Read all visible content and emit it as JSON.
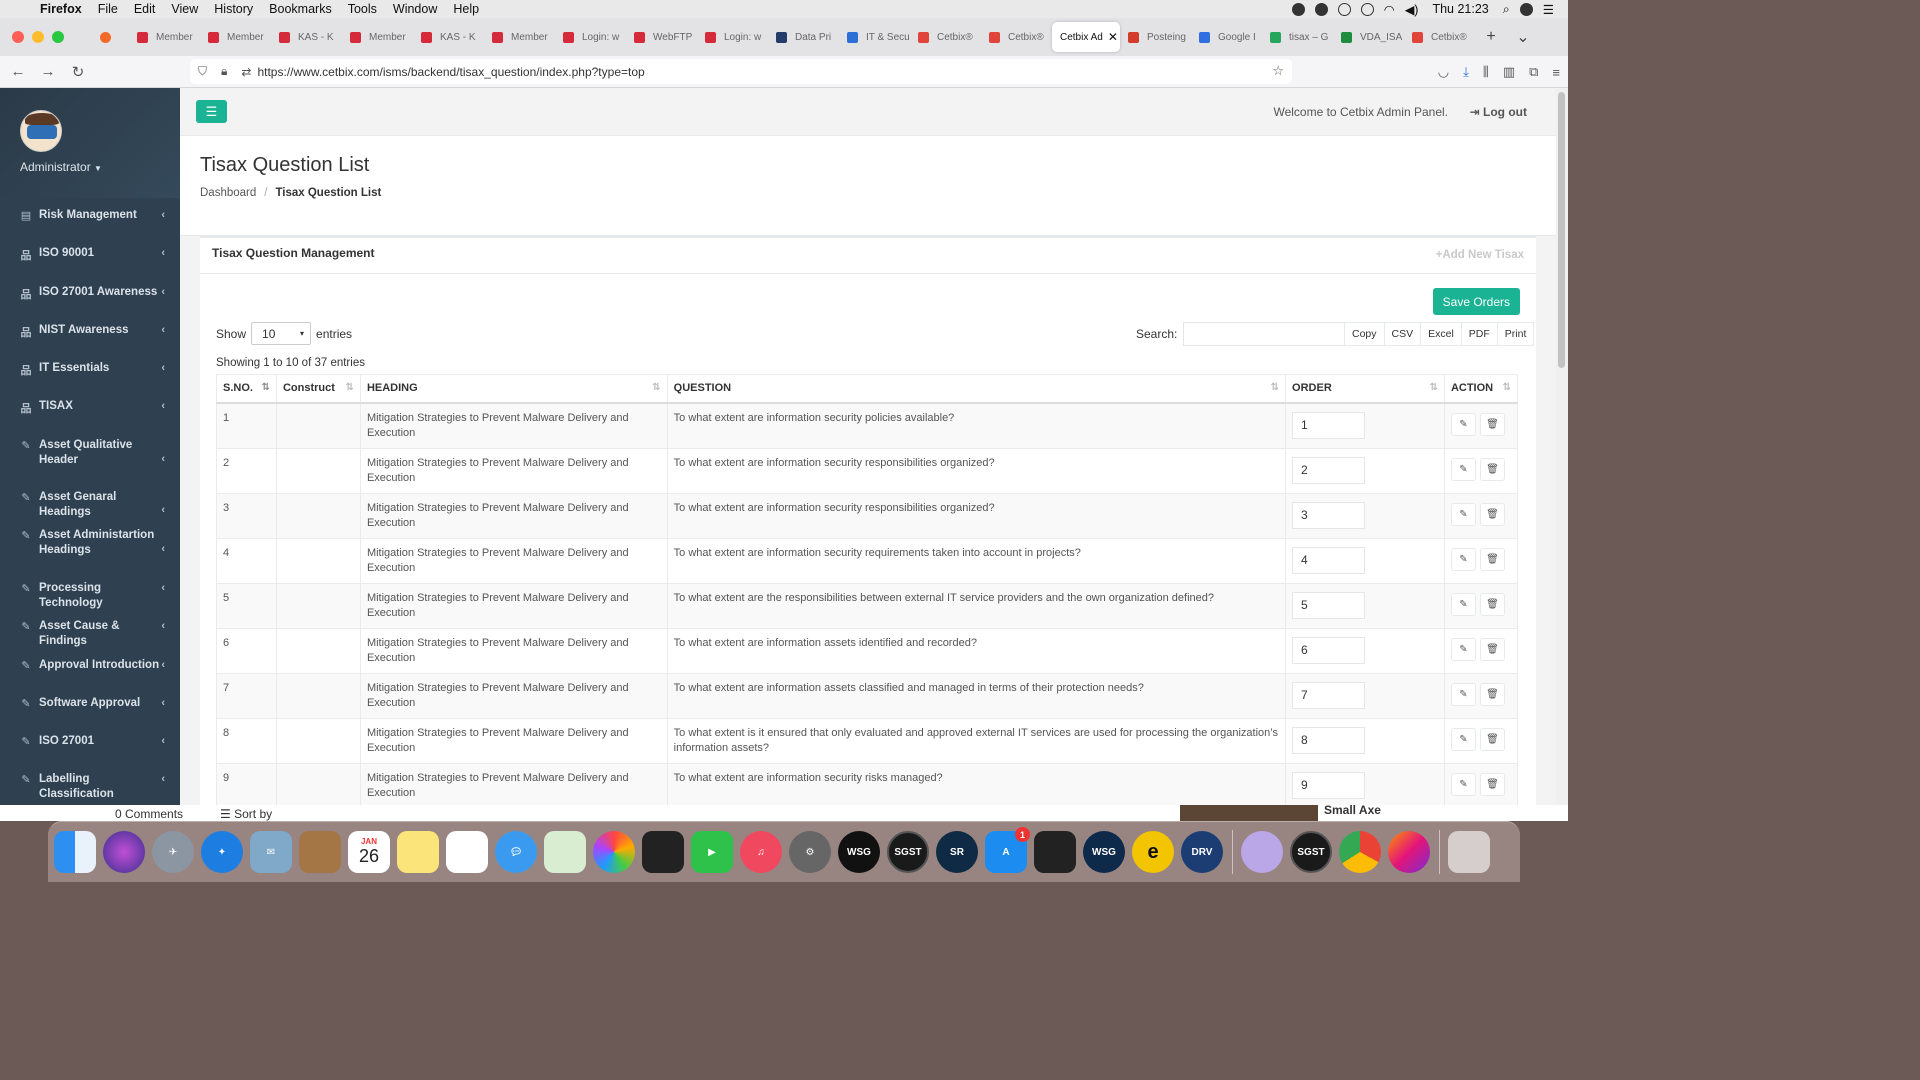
{
  "menubar": {
    "app": "Firefox",
    "items": [
      "File",
      "Edit",
      "View",
      "History",
      "Bookmarks",
      "Tools",
      "Window",
      "Help"
    ],
    "clock": "Thu 21:23"
  },
  "tabs": [
    {
      "label": "Member",
      "color": "#d42a3a"
    },
    {
      "label": "Member",
      "color": "#d42a3a"
    },
    {
      "label": "KAS - K",
      "color": "#d42a3a"
    },
    {
      "label": "Member",
      "color": "#d42a3a"
    },
    {
      "label": "KAS - K",
      "color": "#d42a3a"
    },
    {
      "label": "Member",
      "color": "#d42a3a"
    },
    {
      "label": "Login: w",
      "color": "#d42a3a"
    },
    {
      "label": "WebFTP",
      "color": "#d42a3a"
    },
    {
      "label": "Login: w",
      "color": "#d42a3a"
    },
    {
      "label": "Data Pri",
      "color": "#233c6a"
    },
    {
      "label": "IT & Secu",
      "color": "#2c6fd6"
    },
    {
      "label": "Cetbix®",
      "color": "#e0443a"
    },
    {
      "label": "Cetbix®",
      "color": "#e0443a"
    },
    {
      "label": "Cetbix Ad",
      "color": "#ffffff",
      "active": true
    },
    {
      "label": "Posteing",
      "color": "#d33b2c"
    },
    {
      "label": "Google I",
      "color": "#2f6fe0"
    },
    {
      "label": "tisax – G",
      "color": "#26a65b"
    },
    {
      "label": "VDA_ISA",
      "color": "#1e8e3e"
    },
    {
      "label": "Cetbix®",
      "color": "#e0443a"
    }
  ],
  "url": "https://www.cetbix.com/isms/backend/tisax_question/index.php?type=top",
  "sidebar": {
    "role": "Administrator",
    "items": [
      {
        "label": "Risk Management",
        "icon": "list-icon"
      },
      {
        "label": "ISO 90001",
        "icon": "sitemap-icon"
      },
      {
        "label": "ISO 27001 Awareness",
        "icon": "sitemap-icon"
      },
      {
        "label": "NIST Awareness",
        "icon": "sitemap-icon"
      },
      {
        "label": "IT Essentials",
        "icon": "sitemap-icon"
      },
      {
        "label": "TISAX",
        "icon": "sitemap-icon"
      },
      {
        "label": "Asset Qualitative Header",
        "icon": "edit-icon"
      },
      {
        "label": "Asset Genaral Headings",
        "icon": "edit-icon"
      },
      {
        "label": "Asset Administartion Headings",
        "icon": "edit-icon"
      },
      {
        "label": "Processing Technology",
        "icon": "edit-icon"
      },
      {
        "label": "Asset Cause & Findings",
        "icon": "edit-icon"
      },
      {
        "label": "Approval Introduction",
        "icon": "edit-icon"
      },
      {
        "label": "Software Approval",
        "icon": "edit-icon"
      },
      {
        "label": "ISO 27001",
        "icon": "edit-icon"
      },
      {
        "label": "Labelling Classification",
        "icon": "edit-icon"
      }
    ]
  },
  "topbar": {
    "welcome": "Welcome to Cetbix Admin Panel.",
    "logout": "Log out"
  },
  "page": {
    "title": "Tisax Question List",
    "breadcrumb_home": "Dashboard",
    "breadcrumb_current": "Tisax Question List"
  },
  "panel": {
    "title": "Tisax Question Management",
    "add_new": "Add New Tisax",
    "save_orders": "Save Orders",
    "show_label": "Show",
    "entries_label": "entries",
    "page_size": "10",
    "search_label": "Search:",
    "exports": [
      "Copy",
      "CSV",
      "Excel",
      "PDF",
      "Print"
    ],
    "showing": "Showing 1 to 10 of 37 entries"
  },
  "table": {
    "columns": [
      "S.NO.",
      "Construct",
      "HEADING",
      "QUESTION",
      "ORDER",
      "ACTION"
    ],
    "rows": [
      {
        "sno": "1",
        "construct": "",
        "heading": "Mitigation Strategies to Prevent Malware Delivery and Execution",
        "question": "To what extent are information security policies available?",
        "order": "1"
      },
      {
        "sno": "2",
        "construct": "",
        "heading": "Mitigation Strategies to Prevent Malware Delivery and Execution",
        "question": "To what extent are information security responsibilities organized?",
        "order": "2"
      },
      {
        "sno": "3",
        "construct": "",
        "heading": "Mitigation Strategies to Prevent Malware Delivery and Execution",
        "question": "To what extent are information security responsibilities organized?",
        "order": "3"
      },
      {
        "sno": "4",
        "construct": "",
        "heading": "Mitigation Strategies to Prevent Malware Delivery and Execution",
        "question": "To what extent are information security requirements taken into account in projects?",
        "order": "4"
      },
      {
        "sno": "5",
        "construct": "",
        "heading": "Mitigation Strategies to Prevent Malware Delivery and Execution",
        "question": "To what extent are the responsibilities between external IT service providers and the own organization defined?",
        "order": "5"
      },
      {
        "sno": "6",
        "construct": "",
        "heading": "Mitigation Strategies to Prevent Malware Delivery and Execution",
        "question": "To what extent are information assets identified and recorded?",
        "order": "6"
      },
      {
        "sno": "7",
        "construct": "",
        "heading": "Mitigation Strategies to Prevent Malware Delivery and Execution",
        "question": "To what extent are information assets classified and managed in terms of their protection needs?",
        "order": "7"
      },
      {
        "sno": "8",
        "construct": "",
        "heading": "Mitigation Strategies to Prevent Malware Delivery and Execution",
        "question": "To what extent is it ensured that only evaluated and approved external IT services are used for processing the organization’s information assets?",
        "order": "8"
      },
      {
        "sno": "9",
        "construct": "",
        "heading": "Mitigation Strategies to Prevent Malware Delivery and Execution",
        "question": "To what extent are information security risks managed?",
        "order": "9"
      }
    ]
  },
  "desktop": {
    "comments": "0 Comments",
    "sort": "Sort by",
    "album": "Small Axe"
  },
  "dock": {
    "calendar_month": "JAN",
    "calendar_day": "26",
    "appstore_badge": "1",
    "labels": [
      "WSG",
      "SGST",
      "SR",
      "WSG",
      "DRV",
      "SGST"
    ]
  },
  "colors": {
    "accent": "#1ab394",
    "sidebar": "#2f4050"
  }
}
